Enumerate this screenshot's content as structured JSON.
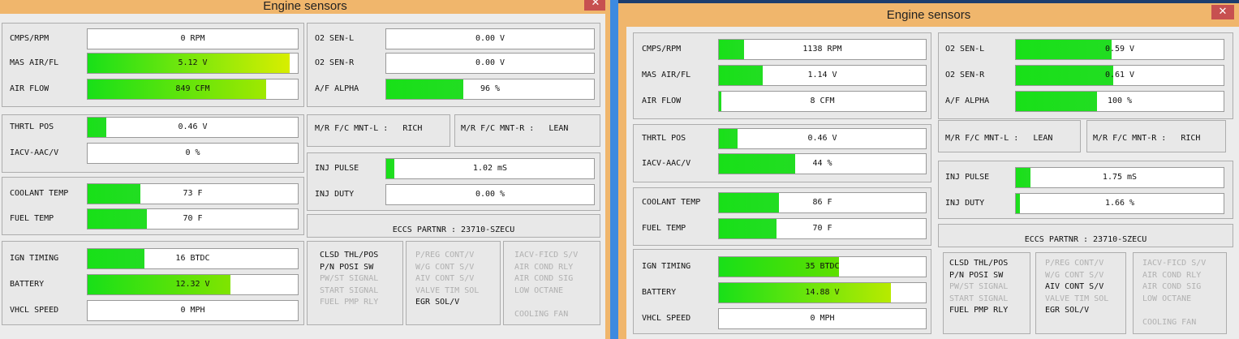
{
  "window_title": "Engine sensors",
  "close_glyph": "✕",
  "left": {
    "readings": [
      {
        "label": "CMPS/RPM",
        "value": "0 RPM",
        "fill": 0,
        "fill_color": "#22dd22"
      },
      {
        "label": "MAS AIR/FL",
        "value": "5.12 V",
        "fill": 0.96,
        "fill_color": "#d8ee00"
      },
      {
        "label": "AIR FLOW",
        "value": "849 CFM",
        "fill": 0.85,
        "fill_color": "#a0e800"
      },
      {
        "label": "THRTL POS",
        "value": "0.46 V",
        "fill": 0.09,
        "fill_color": "#22dd22"
      },
      {
        "label": "IACV-AAC/V",
        "value": "0 %",
        "fill": 0,
        "fill_color": "#22dd22"
      },
      {
        "label": "COOLANT TEMP",
        "value": "73 F",
        "fill": 0.25,
        "fill_color": "#22dd22"
      },
      {
        "label": "FUEL TEMP",
        "value": "70 F",
        "fill": 0.28,
        "fill_color": "#22dd22"
      },
      {
        "label": "IGN TIMING",
        "value": "16 BTDC",
        "fill": 0.27,
        "fill_color": "#22dd22"
      },
      {
        "label": "BATTERY",
        "value": "12.32 V",
        "fill": 0.68,
        "fill_color": "#80e400"
      },
      {
        "label": "VHCL SPEED",
        "value": "0 MPH",
        "fill": 0,
        "fill_color": "#22dd22"
      },
      {
        "label": "O2 SEN-L",
        "value": "0.00 V",
        "fill": 0,
        "fill_color": "#22dd22"
      },
      {
        "label": "O2 SEN-R",
        "value": "0.00 V",
        "fill": 0,
        "fill_color": "#22dd22"
      },
      {
        "label": "A/F ALPHA",
        "value": "96 %",
        "fill": 0.37,
        "fill_color": "#22dd22"
      },
      {
        "label": "INJ PULSE",
        "value": "1.02 mS",
        "fill": 0.04,
        "fill_color": "#22dd22"
      },
      {
        "label": "INJ DUTY",
        "value": "0.00 %",
        "fill": 0,
        "fill_color": "#22dd22"
      }
    ],
    "mnt_l": "M/R F/C MNT-L :   RICH",
    "mnt_r": "M/R F/C MNT-R :   LEAN",
    "partnr": "ECCS PARTNR : 23710-SZECU",
    "statuses": [
      [
        {
          "t": "CLSD THL/POS",
          "on": true
        },
        {
          "t": "P/N POSI SW",
          "on": true
        },
        {
          "t": "PW/ST SIGNAL",
          "on": false
        },
        {
          "t": "START SIGNAL",
          "on": false
        },
        {
          "t": "FUEL PMP RLY",
          "on": false
        }
      ],
      [
        {
          "t": "P/REG CONT/V",
          "on": false
        },
        {
          "t": "W/G CONT S/V",
          "on": false
        },
        {
          "t": "AIV CONT S/V",
          "on": false
        },
        {
          "t": "VALVE TIM SOL",
          "on": false
        },
        {
          "t": "EGR SOL/V",
          "on": true
        }
      ],
      [
        {
          "t": "IACV-FICD S/V",
          "on": false
        },
        {
          "t": "AIR COND RLY",
          "on": false
        },
        {
          "t": "AIR COND SIG",
          "on": false
        },
        {
          "t": "LOW OCTANE",
          "on": false
        },
        {
          "t": "",
          "on": false
        },
        {
          "t": "COOLING FAN",
          "on": false
        }
      ]
    ]
  },
  "right": {
    "readings": [
      {
        "label": "CMPS/RPM",
        "value": "1138 RPM",
        "fill": 0.12,
        "fill_color": "#22dd22"
      },
      {
        "label": "MAS AIR/FL",
        "value": "1.14 V",
        "fill": 0.21,
        "fill_color": "#22dd22"
      },
      {
        "label": "AIR FLOW",
        "value": "8 CFM",
        "fill": 0.01,
        "fill_color": "#22dd22"
      },
      {
        "label": "THRTL POS",
        "value": "0.46 V",
        "fill": 0.09,
        "fill_color": "#22dd22"
      },
      {
        "label": "IACV-AAC/V",
        "value": "44 %",
        "fill": 0.37,
        "fill_color": "#22dd22"
      },
      {
        "label": "COOLANT TEMP",
        "value": "86 F",
        "fill": 0.29,
        "fill_color": "#22dd22"
      },
      {
        "label": "FUEL TEMP",
        "value": "70 F",
        "fill": 0.28,
        "fill_color": "#22dd22"
      },
      {
        "label": "IGN TIMING",
        "value": "35 BTDC",
        "fill": 0.58,
        "fill_color": "#60e000"
      },
      {
        "label": "BATTERY",
        "value": "14.88 V",
        "fill": 0.83,
        "fill_color": "#b8ea00"
      },
      {
        "label": "VHCL SPEED",
        "value": "0 MPH",
        "fill": 0,
        "fill_color": "#22dd22"
      },
      {
        "label": "O2 SEN-L",
        "value": "0.59 V",
        "fill": 0.46,
        "fill_color": "#22dd22"
      },
      {
        "label": "O2 SEN-R",
        "value": "0.61 V",
        "fill": 0.47,
        "fill_color": "#22dd22"
      },
      {
        "label": "A/F ALPHA",
        "value": "100 %",
        "fill": 0.39,
        "fill_color": "#22dd22"
      },
      {
        "label": "INJ PULSE",
        "value": "1.75 mS",
        "fill": 0.07,
        "fill_color": "#22dd22"
      },
      {
        "label": "INJ DUTY",
        "value": "1.66 %",
        "fill": 0.02,
        "fill_color": "#22dd22"
      }
    ],
    "mnt_l": "M/R F/C MNT-L :   LEAN",
    "mnt_r": "M/R F/C MNT-R :   RICH",
    "partnr": "ECCS PARTNR : 23710-SZECU",
    "statuses": [
      [
        {
          "t": "CLSD THL/POS",
          "on": true
        },
        {
          "t": "P/N POSI SW",
          "on": true
        },
        {
          "t": "PW/ST SIGNAL",
          "on": false
        },
        {
          "t": "START SIGNAL",
          "on": false
        },
        {
          "t": "FUEL PMP RLY",
          "on": true
        }
      ],
      [
        {
          "t": "P/REG CONT/V",
          "on": false
        },
        {
          "t": "W/G CONT S/V",
          "on": false
        },
        {
          "t": "AIV CONT S/V",
          "on": true
        },
        {
          "t": "VALVE TIM SOL",
          "on": false
        },
        {
          "t": "EGR SOL/V",
          "on": true
        }
      ],
      [
        {
          "t": "IACV-FICD S/V",
          "on": false
        },
        {
          "t": "AIR COND RLY",
          "on": false
        },
        {
          "t": "AIR COND SIG",
          "on": false
        },
        {
          "t": "LOW OCTANE",
          "on": false
        },
        {
          "t": "",
          "on": false
        },
        {
          "t": "COOLING FAN",
          "on": false
        }
      ]
    ]
  }
}
